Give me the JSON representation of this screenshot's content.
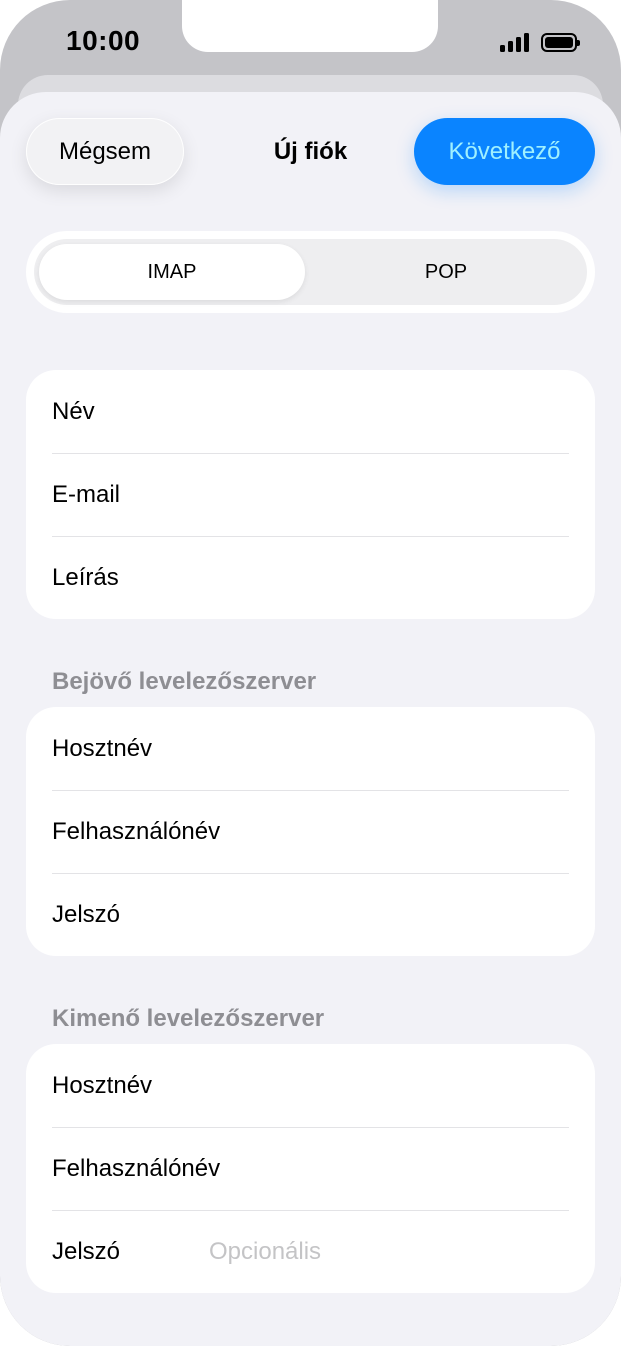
{
  "status": {
    "time": "10:00"
  },
  "nav": {
    "cancel": "Mégsem",
    "title": "Új fiók",
    "next": "Következő"
  },
  "protocol": {
    "options": [
      "IMAP",
      "POP"
    ],
    "selected": "IMAP"
  },
  "account": {
    "rows": [
      {
        "label": "Név",
        "value": "",
        "placeholder": ""
      },
      {
        "label": "E-mail",
        "value": "",
        "placeholder": ""
      },
      {
        "label": "Leírás",
        "value": "",
        "placeholder": ""
      }
    ]
  },
  "incoming": {
    "header": "Bejövő levelezőszerver",
    "rows": [
      {
        "label": "Hosztnév",
        "value": "",
        "placeholder": ""
      },
      {
        "label": "Felhasználónév",
        "value": "",
        "placeholder": ""
      },
      {
        "label": "Jelszó",
        "value": "",
        "placeholder": ""
      }
    ]
  },
  "outgoing": {
    "header": "Kimenő levelezőszerver",
    "rows": [
      {
        "label": "Hosztnév",
        "value": "",
        "placeholder": ""
      },
      {
        "label": "Felhasználónév",
        "value": "",
        "placeholder": ""
      },
      {
        "label": "Jelszó",
        "value": "",
        "placeholder": "Opcionális"
      }
    ]
  },
  "colors": {
    "accent": "#0a84ff",
    "background": "#f2f2f7",
    "secondary_text": "#8e8e93"
  }
}
